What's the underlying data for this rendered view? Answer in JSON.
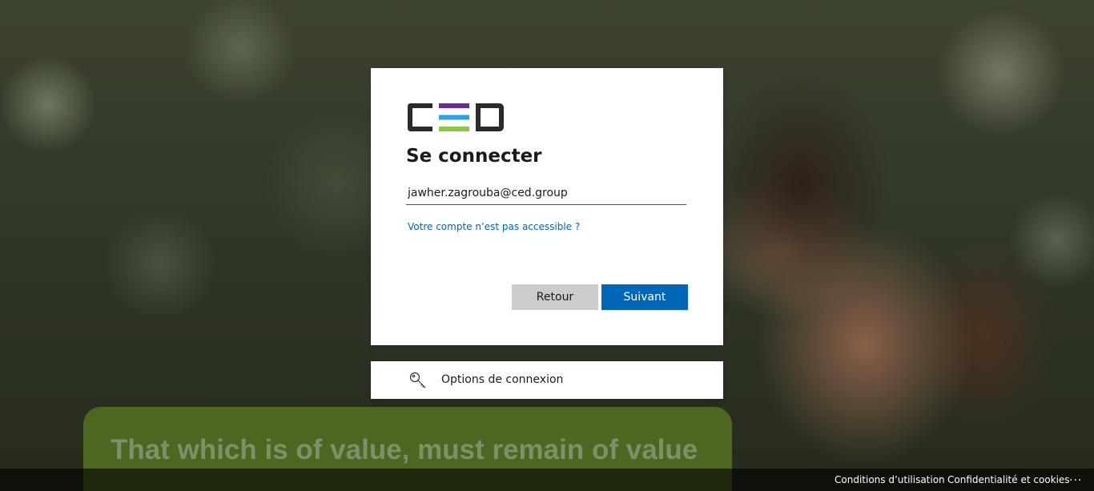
{
  "background": {
    "slogan": "That which is of value, must remain of value"
  },
  "signin": {
    "logo_text": "CED",
    "title": "Se connecter",
    "email_value": "jawher.zagrouba@ced.group",
    "account_link": "Votre compte n’est pas accessible ?",
    "back_label": "Retour",
    "next_label": "Suivant"
  },
  "options": {
    "label": "Options de connexion",
    "icon": "key-icon"
  },
  "footer": {
    "terms": "Conditions d’utilisation",
    "privacy": "Confidentialité et cookies",
    "more": "..."
  },
  "colors": {
    "accent": "#0067b8",
    "logo_dark": "#2b2b2b",
    "logo_purple": "#6b2c91",
    "logo_blue": "#2aa4dc",
    "logo_green": "#8dc63f"
  }
}
